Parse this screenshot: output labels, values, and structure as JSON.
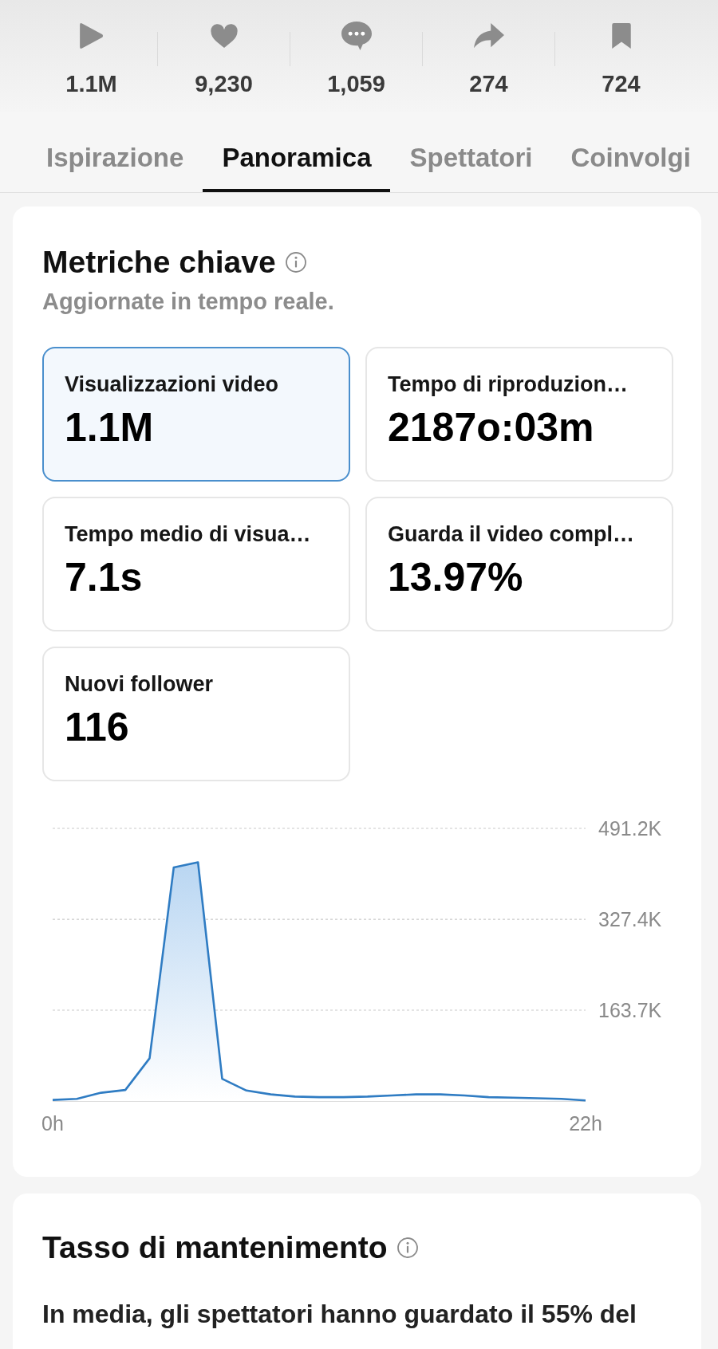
{
  "stats": [
    {
      "kind": "views",
      "value": "1.1M"
    },
    {
      "kind": "likes",
      "value": "9,230"
    },
    {
      "kind": "comments",
      "value": "1,059"
    },
    {
      "kind": "shares",
      "value": "274"
    },
    {
      "kind": "saves",
      "value": "724"
    }
  ],
  "tabs": [
    {
      "label": "Ispirazione",
      "selected": false
    },
    {
      "label": "Panoramica",
      "selected": true
    },
    {
      "label": "Spettatori",
      "selected": false
    },
    {
      "label": "Coinvolgi",
      "selected": false
    }
  ],
  "key_metrics": {
    "title": "Metriche chiave",
    "subtitle": "Aggiornate in tempo reale.",
    "cards": [
      {
        "label": "Visualizzazioni video",
        "value": "1.1M",
        "selected": true
      },
      {
        "label": "Tempo di riproduzion…",
        "value": "2187o:03m",
        "selected": false
      },
      {
        "label": "Tempo medio di visua…",
        "value": "7.1s",
        "selected": false
      },
      {
        "label": "Guarda il video compl…",
        "value": "13.97%",
        "selected": false
      },
      {
        "label": "Nuovi follower",
        "value": "116",
        "selected": false
      }
    ],
    "chart_data": {
      "type": "area",
      "x": [
        0,
        1,
        2,
        3,
        4,
        5,
        6,
        7,
        8,
        9,
        10,
        11,
        12,
        13,
        14,
        15,
        16,
        17,
        18,
        19,
        20,
        21,
        22
      ],
      "values": [
        2,
        4,
        15,
        20,
        77,
        421,
        430,
        40,
        19,
        12,
        8,
        7,
        7,
        8,
        10,
        12,
        12,
        10,
        7,
        6,
        5,
        4,
        1
      ],
      "xlim": [
        0,
        22
      ],
      "ylim": [
        0,
        491.2
      ],
      "yticks": [
        {
          "value": 163.7,
          "label": "163.7K"
        },
        {
          "value": 327.4,
          "label": "327.4K"
        },
        {
          "value": 491.2,
          "label": "491.2K"
        }
      ],
      "xticks": [
        {
          "value": 0,
          "label": "0h"
        },
        {
          "value": 22,
          "label": "22h"
        }
      ]
    }
  },
  "retention": {
    "title": "Tasso di mantenimento",
    "summary": "In media, gli spettatori hanno guardato il 55% del"
  }
}
